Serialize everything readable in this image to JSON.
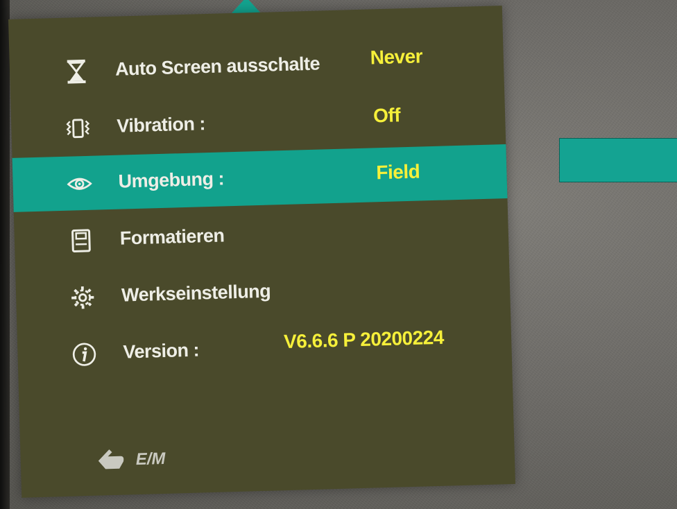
{
  "menu": {
    "items": [
      {
        "label": "Auto Screen ausschalte",
        "value": "Never",
        "icon": "hourglass-icon"
      },
      {
        "label": "Vibration :",
        "value": "Off",
        "icon": "vibration-icon"
      },
      {
        "label": "Umgebung :",
        "value": "Field",
        "icon": "eye-icon",
        "selected": true
      },
      {
        "label": "Formatieren",
        "value": "",
        "icon": "sd-card-icon"
      },
      {
        "label": "Werkseinstellung",
        "value": "",
        "icon": "gear-icon"
      },
      {
        "label": "Version :",
        "value": "V6.6.6 P 20200224",
        "icon": "info-icon"
      }
    ],
    "footer": {
      "icon": "back-icon",
      "label": "E/M"
    }
  },
  "colors": {
    "panel": "#4a4a2b",
    "highlight": "#12a28d",
    "value_text": "#f6f03a",
    "label_text": "#eeeee6"
  }
}
